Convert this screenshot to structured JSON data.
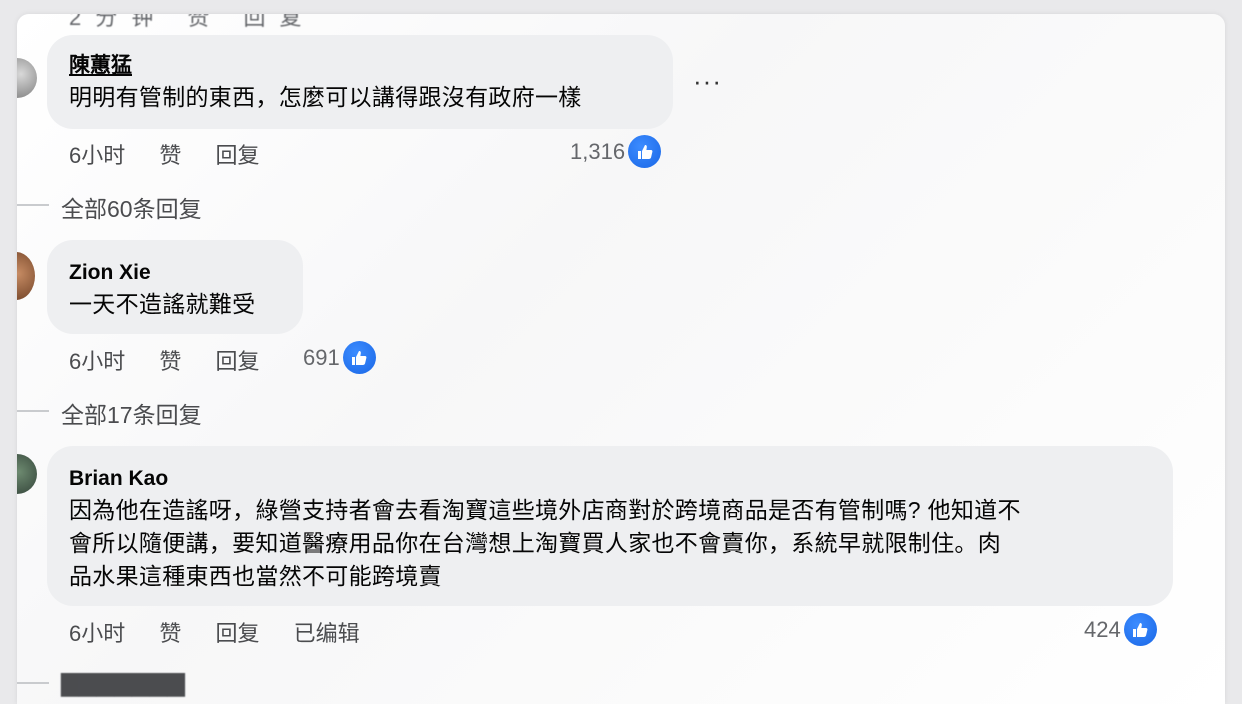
{
  "comments": [
    {
      "author": "陳蕙猛",
      "text": "明明有管制的東西，怎麼可以講得跟沒有政府一樣",
      "time": "6小时",
      "like_label": "赞",
      "reply_label": "回复",
      "likes": "1,316",
      "replies": "全部60条回复"
    },
    {
      "author": "Zion Xie",
      "text": "一天不造謠就難受",
      "time": "6小时",
      "like_label": "赞",
      "reply_label": "回复",
      "likes": "691",
      "replies": "全部17条回复"
    },
    {
      "author": "Brian Kao",
      "text_lines": [
        "因為他在造謠呀，綠營支持者會去看淘寶這些境外店商對於跨境商品是否有管制嗎? 他知道不",
        "會所以隨便講，要知道醫療用品你在台灣想上淘寶買人家也不會賣你，系統早就限制住。肉",
        "品水果這種東西也當然不可能跨境賣"
      ],
      "time": "6小时",
      "like_label": "赞",
      "reply_label": "回复",
      "edited_label": "已编辑",
      "likes": "424"
    }
  ],
  "more_menu": "···",
  "colors": {
    "like_blue": "#1877f2",
    "bubble": "#eeeff1"
  },
  "icons": [
    "avatar",
    "like-thumb-icon",
    "more-options-icon"
  ]
}
